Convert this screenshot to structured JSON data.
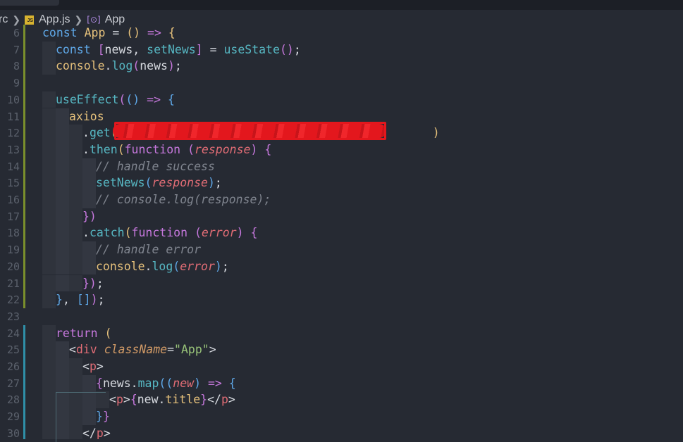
{
  "breadcrumb": {
    "items": [
      "rc",
      "App.js",
      "App"
    ],
    "js_badge": "JS"
  },
  "editor": {
    "lines": [
      {
        "n": "6",
        "tokens": [
          [
            "kw",
            "const "
          ],
          [
            "var",
            "App"
          ],
          [
            "plain",
            " = "
          ],
          [
            "p1",
            "()"
          ],
          [
            "plain",
            " "
          ],
          [
            "kw2",
            "=>"
          ],
          [
            "plain",
            " "
          ],
          [
            "p1",
            "{"
          ]
        ]
      },
      {
        "n": "7",
        "tokens": [
          [
            "kw",
            "const "
          ],
          [
            "p2",
            "["
          ],
          [
            "plain",
            "news, "
          ],
          [
            "fn",
            "setNews"
          ],
          [
            "p2",
            "]"
          ],
          [
            "plain",
            " = "
          ],
          [
            "fn",
            "useState"
          ],
          [
            "p2",
            "()"
          ],
          [
            "plain",
            ";"
          ]
        ]
      },
      {
        "n": "8",
        "tokens": [
          [
            "var",
            "console"
          ],
          [
            "plain",
            "."
          ],
          [
            "fn",
            "log"
          ],
          [
            "p2",
            "("
          ],
          [
            "plain",
            "news"
          ],
          [
            "p2",
            ")"
          ],
          [
            "plain",
            ";"
          ]
        ]
      },
      {
        "n": "9",
        "tokens": []
      },
      {
        "n": "10",
        "tokens": [
          [
            "fn",
            "useEffect"
          ],
          [
            "p2",
            "("
          ],
          [
            "p3",
            "()"
          ],
          [
            "plain",
            " "
          ],
          [
            "kw2",
            "=>"
          ],
          [
            "plain",
            " "
          ],
          [
            "p3",
            "{"
          ]
        ]
      },
      {
        "n": "11",
        "tokens": [
          [
            "var",
            "axios"
          ]
        ]
      },
      {
        "n": "12",
        "tokens": [
          [
            "plain",
            "."
          ],
          [
            "fn",
            "get"
          ],
          [
            "p1",
            "("
          ],
          [
            "plain",
            "                                             "
          ],
          [
            "p1",
            ")"
          ]
        ]
      },
      {
        "n": "13",
        "tokens": [
          [
            "plain",
            "."
          ],
          [
            "fn",
            "then"
          ],
          [
            "p1",
            "("
          ],
          [
            "kw2",
            "function"
          ],
          [
            "plain",
            " "
          ],
          [
            "p2",
            "("
          ],
          [
            "param",
            "response"
          ],
          [
            "p2",
            ")"
          ],
          [
            "plain",
            " "
          ],
          [
            "p2",
            "{"
          ]
        ]
      },
      {
        "n": "14",
        "tokens": [
          [
            "cmt",
            "// handle success"
          ]
        ]
      },
      {
        "n": "15",
        "tokens": [
          [
            "fn",
            "setNews"
          ],
          [
            "p3",
            "("
          ],
          [
            "param",
            "response"
          ],
          [
            "p3",
            ")"
          ],
          [
            "plain",
            ";"
          ]
        ]
      },
      {
        "n": "16",
        "tokens": [
          [
            "cmt",
            "// console.log(response);"
          ]
        ]
      },
      {
        "n": "17",
        "tokens": [
          [
            "p2",
            "})"
          ]
        ]
      },
      {
        "n": "18",
        "tokens": [
          [
            "plain",
            "."
          ],
          [
            "fn",
            "catch"
          ],
          [
            "p1",
            "("
          ],
          [
            "kw2",
            "function"
          ],
          [
            "plain",
            " "
          ],
          [
            "p2",
            "("
          ],
          [
            "param",
            "error"
          ],
          [
            "p2",
            ")"
          ],
          [
            "plain",
            " "
          ],
          [
            "p2",
            "{"
          ]
        ]
      },
      {
        "n": "19",
        "tokens": [
          [
            "cmt",
            "// handle error"
          ]
        ]
      },
      {
        "n": "20",
        "tokens": [
          [
            "var",
            "console"
          ],
          [
            "plain",
            "."
          ],
          [
            "fn",
            "log"
          ],
          [
            "p3",
            "("
          ],
          [
            "param",
            "error"
          ],
          [
            "p3",
            ")"
          ],
          [
            "plain",
            ";"
          ]
        ]
      },
      {
        "n": "21",
        "tokens": [
          [
            "p2",
            "})"
          ],
          [
            "plain",
            ";"
          ]
        ]
      },
      {
        "n": "22",
        "tokens": [
          [
            "p3",
            "}"
          ],
          [
            "plain",
            ", "
          ],
          [
            "p3",
            "[]"
          ],
          [
            "p2",
            ")"
          ],
          [
            "plain",
            ";"
          ]
        ]
      },
      {
        "n": "23",
        "tokens": []
      },
      {
        "n": "24",
        "tokens": [
          [
            "kw2",
            "return"
          ],
          [
            "plain",
            " "
          ],
          [
            "p1",
            "("
          ]
        ]
      },
      {
        "n": "25",
        "tokens": [
          [
            "plain",
            "<"
          ],
          [
            "tag",
            "div"
          ],
          [
            "plain",
            " "
          ],
          [
            "attr",
            "className"
          ],
          [
            "plain",
            "="
          ],
          [
            "str",
            "\"App\""
          ],
          [
            "plain",
            ">"
          ]
        ]
      },
      {
        "n": "26",
        "tokens": [
          [
            "plain",
            "<"
          ],
          [
            "tag",
            "p"
          ],
          [
            "plain",
            ">"
          ]
        ]
      },
      {
        "n": "27",
        "tokens": [
          [
            "p2",
            "{"
          ],
          [
            "plain",
            "news."
          ],
          [
            "fn",
            "map"
          ],
          [
            "p3",
            "("
          ],
          [
            "p3",
            "("
          ],
          [
            "param",
            "new"
          ],
          [
            "p3",
            ")"
          ],
          [
            "plain",
            " "
          ],
          [
            "kw2",
            "=>"
          ],
          [
            "plain",
            " "
          ],
          [
            "p3",
            "{"
          ]
        ]
      },
      {
        "n": "28",
        "tokens": [
          [
            "plain",
            "<"
          ],
          [
            "tag",
            "p"
          ],
          [
            "plain",
            ">"
          ],
          [
            "p2",
            "{"
          ],
          [
            "plain",
            "new."
          ],
          [
            "var",
            "title"
          ],
          [
            "p2",
            "}"
          ],
          [
            "plain",
            "</"
          ],
          [
            "tag",
            "p"
          ],
          [
            "plain",
            ">"
          ]
        ]
      },
      {
        "n": "29",
        "tokens": [
          [
            "p3",
            "}"
          ],
          [
            "p2",
            "}"
          ]
        ]
      },
      {
        "n": "30",
        "tokens": [
          [
            "plain",
            "</"
          ],
          [
            "tag",
            "p"
          ],
          [
            "plain",
            ">"
          ]
        ]
      }
    ]
  }
}
